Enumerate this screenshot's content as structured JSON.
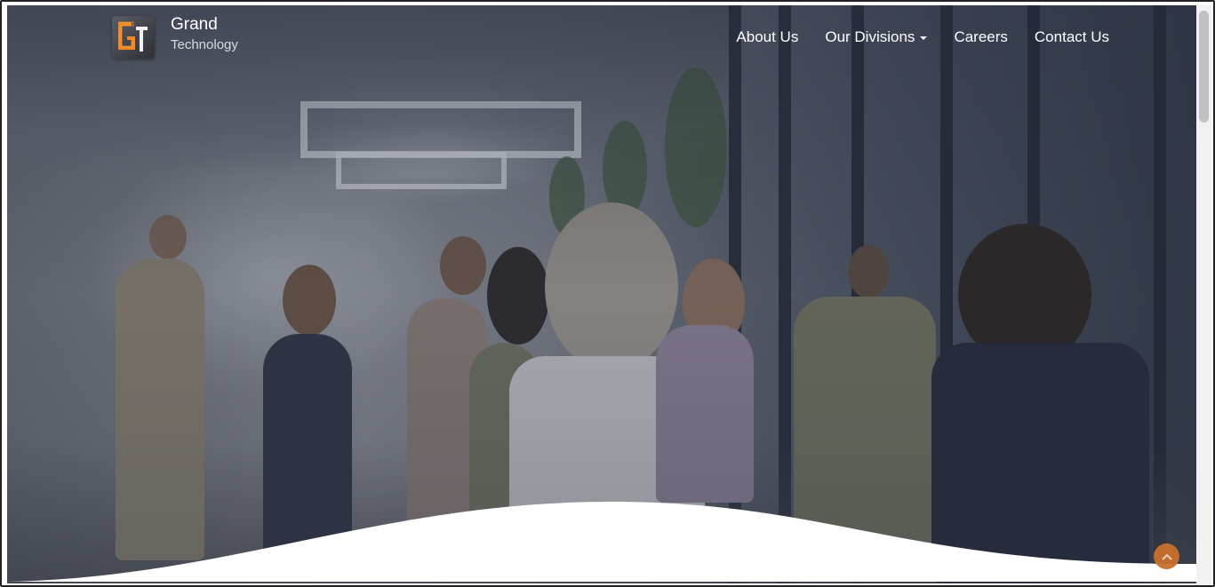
{
  "brand": {
    "name": "Grand",
    "subtitle": "Technology",
    "logo_icon": "gt-logo-icon",
    "logo_letters": "GT"
  },
  "nav": {
    "items": [
      {
        "label": "About Us",
        "has_dropdown": false
      },
      {
        "label": "Our Divisions",
        "has_dropdown": true
      },
      {
        "label": "Careers",
        "has_dropdown": false
      },
      {
        "label": "Contact Us",
        "has_dropdown": false
      }
    ]
  },
  "hero": {
    "background": "office-networking-photo",
    "overlay_color": "#2a2f3f"
  },
  "scroll_top": {
    "icon": "chevron-up-icon",
    "color": "#c8702d"
  },
  "colors": {
    "accent": "#c8702d",
    "nav_text": "#ffffff"
  }
}
